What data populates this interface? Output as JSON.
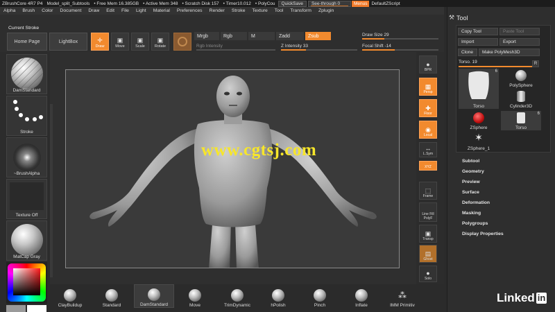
{
  "titlebar": {
    "app": "ZBrushCore 4R7 P4",
    "file": "Model_split_Subtools",
    "free_mem": "• Free Mem 16.385GB",
    "active_mem": "• Active Mem 348",
    "scratch": "• Scratch Disk 157",
    "timer": "• Timer10.012",
    "poly": "• PolyCou",
    "quicksave": "QuickSave",
    "seethrough": "See-through  0",
    "menus": "Menus",
    "script": "DefaultZScript"
  },
  "menubar": [
    "Alpha",
    "Brush",
    "Color",
    "Document",
    "Draw",
    "Edit",
    "File",
    "Light",
    "Material",
    "Preferences",
    "Render",
    "Stroke",
    "Texture",
    "Tool",
    "Transform",
    "Zplugin"
  ],
  "left_header": {
    "current_stroke": "Current Stroke",
    "home_page": "Home Page",
    "lightbox": "LightBox"
  },
  "toolbar": {
    "draw": "Draw",
    "move": "Move",
    "scale": "Scale",
    "rotate": "Rotate",
    "mrgb": "Mrgb",
    "rgb": "Rgb",
    "m": "M",
    "zadd": "Zadd",
    "zsub": "Zsub",
    "rgb_intensity": "Rgb Intensity",
    "z_intensity": "Z Intensity 33",
    "draw_size": "Draw Size 29",
    "focal_shift": "Focal Shift -14",
    "z_intensity_value": 33,
    "draw_size_value": 29,
    "focal_shift_value": -14
  },
  "left_slots": {
    "brush": "DamStandard",
    "stroke": "Stroke",
    "alpha": "~BrushAlpha",
    "texture": "Texture Off",
    "material": "MatCap Gray"
  },
  "nav": {
    "bpr": "BPR",
    "persp": "Persp",
    "floor": "Floor",
    "local": "Local",
    "lsym": "L.Sym",
    "xyz": "XYZ",
    "frame": "Frame",
    "line_fill": "Line Fill",
    "polyf": "PolyF",
    "transp": "Transp",
    "ghost": "Ghost",
    "solo": "Solo"
  },
  "watermark": "www.cgtsj.com",
  "tool_panel": {
    "title": "Tool",
    "copy_tool": "Copy Tool",
    "paste_tool": "Paste Tool",
    "import": "Import",
    "export": "Export",
    "clone": "Clone",
    "make_polymesh": "Make PolyMesh3D",
    "torso_slider": "Torso. 19",
    "torso_value": 19,
    "r": "R",
    "thumbs": [
      {
        "label": "Torso",
        "count": "6"
      },
      {
        "label": "PolySphere",
        "count": ""
      },
      {
        "label": "Cylinder3D",
        "count": ""
      },
      {
        "label": "ZSphere",
        "count": ""
      },
      {
        "label": "Torso",
        "count": "6"
      },
      {
        "label": "ZSphere_1",
        "count": ""
      }
    ],
    "subpalettes": [
      "Subtool",
      "Geometry",
      "Preview",
      "Surface",
      "Deformation",
      "Masking",
      "Polygroups",
      "Display Properties"
    ]
  },
  "shelf": [
    "ClayBuildup",
    "Standard",
    "DamStandard",
    "Move",
    "TrimDynamic",
    "hPolish",
    "Pinch",
    "Inflate",
    "IMM Primitiv"
  ],
  "brand": {
    "linked": "Linked",
    "in": "in"
  },
  "colors": {
    "accent": "#f28a2e",
    "watermark": "#f7e62a"
  }
}
